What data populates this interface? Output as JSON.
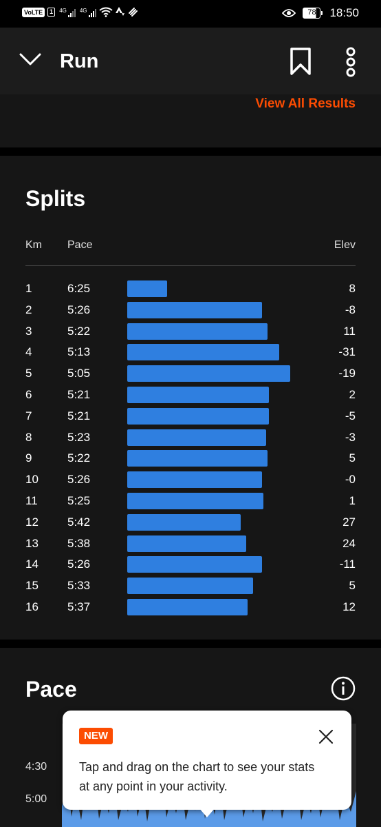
{
  "status_bar": {
    "volte": "VoLTE",
    "sim": "1",
    "network1": "4G",
    "network2": "4G",
    "battery": "78",
    "time": "18:50"
  },
  "header": {
    "title": "Run",
    "icons": [
      "chevron-down-icon",
      "bookmark-icon",
      "more-vertical-icon"
    ]
  },
  "results": {
    "view_all_label": "View All Results",
    "accent_color": "#fc4c02"
  },
  "splits": {
    "title": "Splits",
    "columns": {
      "km": "Km",
      "pace": "Pace",
      "elev": "Elev"
    },
    "bar_color": "#2f7fe0",
    "rows": [
      {
        "km": "1",
        "pace": "6:25",
        "elev": "8"
      },
      {
        "km": "2",
        "pace": "5:26",
        "elev": "-8"
      },
      {
        "km": "3",
        "pace": "5:22",
        "elev": "11"
      },
      {
        "km": "4",
        "pace": "5:13",
        "elev": "-31"
      },
      {
        "km": "5",
        "pace": "5:05",
        "elev": "-19"
      },
      {
        "km": "6",
        "pace": "5:21",
        "elev": "2"
      },
      {
        "km": "7",
        "pace": "5:21",
        "elev": "-5"
      },
      {
        "km": "8",
        "pace": "5:23",
        "elev": "-3"
      },
      {
        "km": "9",
        "pace": "5:22",
        "elev": "5"
      },
      {
        "km": "10",
        "pace": "5:26",
        "elev": "-0"
      },
      {
        "km": "11",
        "pace": "5:25",
        "elev": "1"
      },
      {
        "km": "12",
        "pace": "5:42",
        "elev": "27"
      },
      {
        "km": "13",
        "pace": "5:38",
        "elev": "24"
      },
      {
        "km": "14",
        "pace": "5:26",
        "elev": "-11"
      },
      {
        "km": "15",
        "pace": "5:33",
        "elev": "5"
      },
      {
        "km": "16",
        "pace": "5:37",
        "elev": "12"
      }
    ]
  },
  "pace": {
    "title": "Pace",
    "axis_labels": [
      "4:30",
      "5:00"
    ]
  },
  "tooltip": {
    "badge": "NEW",
    "text": "Tap and drag on the chart to see your stats at any point in your activity."
  }
}
